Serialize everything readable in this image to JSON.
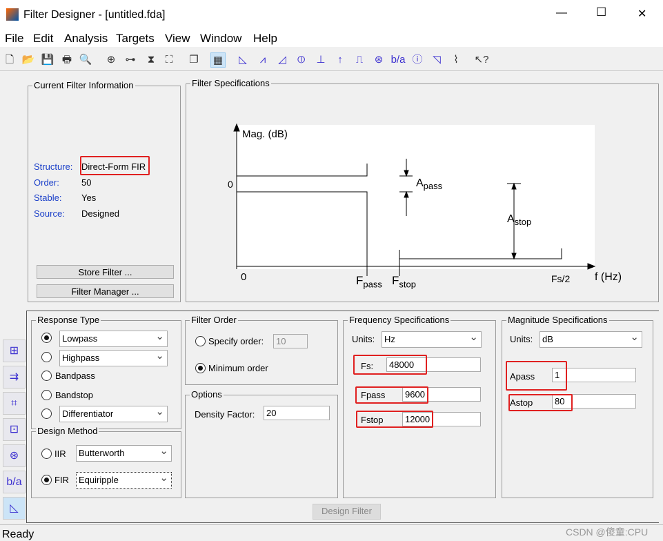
{
  "window": {
    "title": "Filter Designer - [untitled.fda]",
    "minimize": "—",
    "maximize": "☐",
    "close": "✕"
  },
  "menu": [
    "File",
    "Edit",
    "Analysis",
    "Targets",
    "View",
    "Window",
    "Help"
  ],
  "toolbar": [
    "new-icon",
    "open-icon",
    "save-icon",
    "print-icon",
    "print-preview-icon",
    "zoom-in-icon",
    "zoom-x-icon",
    "zoom-y-icon",
    "full-view-icon",
    "new-figure-icon",
    "filter-specs-icon",
    "magnitude-response-icon",
    "phase-response-icon",
    "magnitude-phase-icon",
    "group-delay-icon",
    "phase-delay-icon",
    "impulse-response-icon",
    "step-response-icon",
    "pole-zero-icon",
    "coefficients-icon",
    "filter-info-icon",
    "magnitude-estimate-icon",
    "round-off-noise-icon",
    "whats-this-icon"
  ],
  "current_filter": {
    "title": "Current Filter Information",
    "rows": [
      {
        "label": "Structure:",
        "value": "Direct-Form FIR"
      },
      {
        "label": "Order:",
        "value": "50"
      },
      {
        "label": "Stable:",
        "value": "Yes"
      },
      {
        "label": "Source:",
        "value": "Designed"
      }
    ],
    "store_filter": "Store Filter ...",
    "filter_manager": "Filter Manager ..."
  },
  "filter_specs": {
    "title": "Filter Specifications",
    "ylabel": "Mag. (dB)",
    "y0": "0",
    "x0": "0",
    "fpass": "F",
    "fpass_sub": "pass",
    "fstop": "F",
    "fstop_sub": "stop",
    "fs2": "Fs/2",
    "xlabel": "f (Hz)",
    "apass": "A",
    "apass_sub": "pass",
    "astop": "A",
    "astop_sub": "stop"
  },
  "response_type": {
    "title": "Response Type",
    "options": [
      {
        "label": "Lowpass",
        "selected": true
      },
      {
        "label": "Highpass"
      },
      {
        "label": "Bandpass"
      },
      {
        "label": "Bandstop"
      },
      {
        "label": "Differentiator"
      }
    ]
  },
  "design_method": {
    "title": "Design Method",
    "iir": "IIR",
    "iir_value": "Butterworth",
    "fir": "FIR",
    "fir_value": "Equiripple",
    "selected": "FIR"
  },
  "filter_order": {
    "title": "Filter Order",
    "specify": "Specify order:",
    "specify_value": "10",
    "minimum": "Minimum order",
    "selected": "Minimum order"
  },
  "options": {
    "title": "Options",
    "density_label": "Density Factor:",
    "density_value": "20"
  },
  "frequency": {
    "title": "Frequency Specifications",
    "units_label": "Units:",
    "units": "Hz",
    "fs_label": "Fs:",
    "fs": "48000",
    "fpass_label": "Fpass",
    "fpass": "9600",
    "fstop_label": "Fstop",
    "fstop": "12000"
  },
  "magnitude": {
    "title": "Magnitude Specifications",
    "units_label": "Units:",
    "units": "dB",
    "apass_label": "Apass",
    "apass": "1",
    "astop_label": "Astop",
    "astop": "80"
  },
  "design_button": "Design Filter",
  "sidebar": [
    "transform-filter-icon",
    "realize-model-icon",
    "quantize-icon",
    "import-filter-icon",
    "pole-zero-editor-icon",
    "multirate-icon",
    "design-filter-icon"
  ],
  "status": "Ready",
  "watermark": "CSDN @傻童:CPU",
  "colors": {
    "highlight": "#e02020",
    "label_blue": "#1a3fc9"
  }
}
